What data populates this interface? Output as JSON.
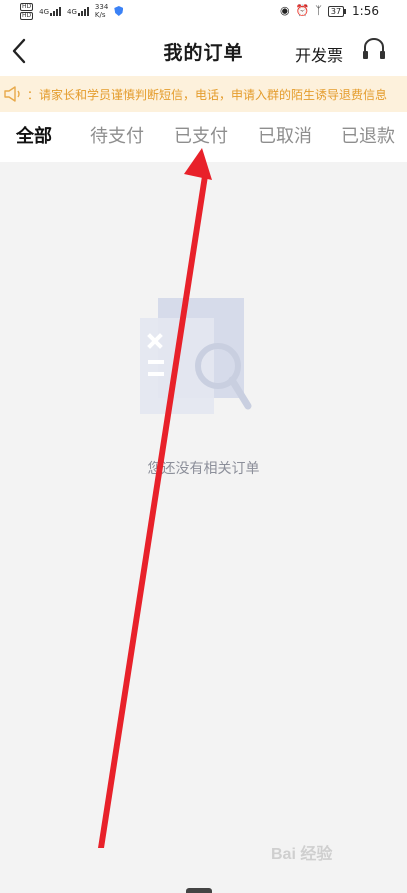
{
  "status_bar": {
    "hd_badges": [
      "HD",
      "HD"
    ],
    "network_1": "4G",
    "network_2": "4G",
    "speed_value": "334",
    "speed_unit": "K/s",
    "battery": "37",
    "time": "1:56"
  },
  "header": {
    "title": "我的订单",
    "invoice_label": "开发票"
  },
  "notice": {
    "text": "：请家长和学员谨慎判断短信，电话，申请入群的陌生诱导退费信息"
  },
  "tabs": [
    {
      "label": "全部",
      "active": true
    },
    {
      "label": "待支付",
      "active": false
    },
    {
      "label": "已支付",
      "active": false
    },
    {
      "label": "已取消",
      "active": false
    },
    {
      "label": "已退款",
      "active": false
    }
  ],
  "empty_state": {
    "text": "您还没有相关订单"
  },
  "watermark": {
    "text": "Bai 经验"
  },
  "colors": {
    "notice_bg": "#fdf1dc",
    "notice_text": "#e49c2c",
    "arrow": "#e8212a",
    "tab_active": "#111111",
    "tab_inactive": "#8e8e8e"
  }
}
